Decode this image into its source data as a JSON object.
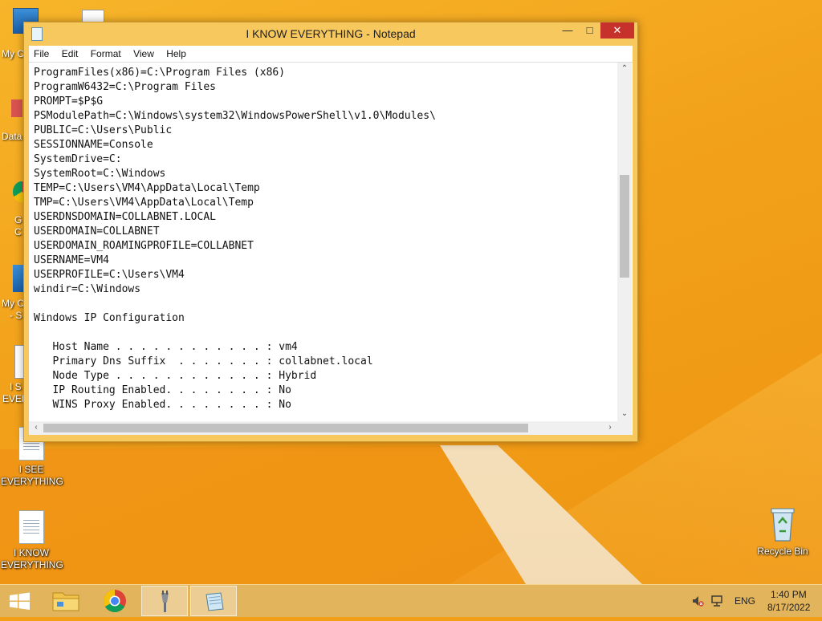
{
  "desktop": {
    "icons": [
      {
        "label_lines": [
          "I SEE",
          "EVERYTHING"
        ]
      },
      {
        "label_lines": [
          "I KNOW",
          "EVERYTHING"
        ]
      },
      {
        "label_lines": [
          "Recycle Bin"
        ]
      }
    ],
    "partial_labels": [
      "My C",
      "Data",
      "G",
      "C",
      "My C",
      "- S",
      "I S",
      "EVER"
    ]
  },
  "window": {
    "title": "I KNOW EVERYTHING - Notepad",
    "controls": {
      "minimize": "—",
      "maximize": "□",
      "close": "✕"
    },
    "menu": [
      "File",
      "Edit",
      "Format",
      "View",
      "Help"
    ],
    "content_lines": [
      "ProgramFiles(x86)=C:\\Program Files (x86)",
      "ProgramW6432=C:\\Program Files",
      "PROMPT=$P$G",
      "PSModulePath=C:\\Windows\\system32\\WindowsPowerShell\\v1.0\\Modules\\",
      "PUBLIC=C:\\Users\\Public",
      "SESSIONNAME=Console",
      "SystemDrive=C:",
      "SystemRoot=C:\\Windows",
      "TEMP=C:\\Users\\VM4\\AppData\\Local\\Temp",
      "TMP=C:\\Users\\VM4\\AppData\\Local\\Temp",
      "USERDNSDOMAIN=COLLABNET.LOCAL",
      "USERDOMAIN=COLLABNET",
      "USERDOMAIN_ROAMINGPROFILE=COLLABNET",
      "USERNAME=VM4",
      "USERPROFILE=C:\\Users\\VM4",
      "windir=C:\\Windows",
      "",
      "Windows IP Configuration",
      "",
      "   Host Name . . . . . . . . . . . . : vm4",
      "   Primary Dns Suffix  . . . . . . . : collabnet.local",
      "   Node Type . . . . . . . . . . . . : Hybrid",
      "   IP Routing Enabled. . . . . . . . : No",
      "   WINS Proxy Enabled. . . . . . . . : No"
    ]
  },
  "taskbar": {
    "apps": [
      "start-button",
      "file-explorer",
      "chrome",
      "network-tool",
      "notepad"
    ],
    "active_app": "notepad",
    "language": "ENG",
    "time": "1:40 PM",
    "date": "8/17/2022"
  },
  "colors": {
    "accent": "#f2a11a",
    "close_button": "#c7312b"
  }
}
